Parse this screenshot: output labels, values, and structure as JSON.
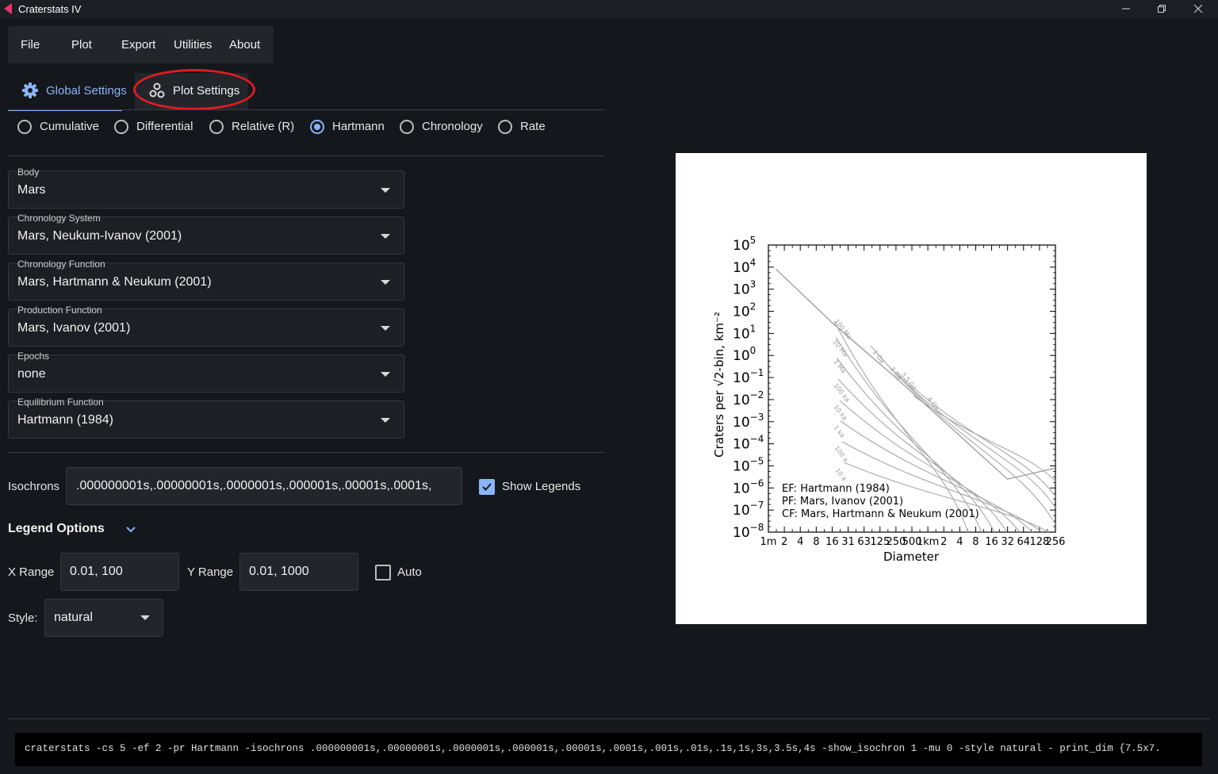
{
  "window": {
    "title": "Craterstats IV",
    "icon": "craterstats-logo-icon",
    "controls": [
      "minimize-icon",
      "maximize-icon",
      "close-icon"
    ]
  },
  "menu": [
    "File",
    "Plot",
    "Export",
    "Utilities",
    "About"
  ],
  "tabs": [
    {
      "label": "Global Settings",
      "icon": "gear-icon",
      "active": true
    },
    {
      "label": "Plot Settings",
      "icon": "plot-settings-icon",
      "active": false,
      "highlighted": true
    }
  ],
  "presentation": {
    "options": [
      "Cumulative",
      "Differential",
      "Relative (R)",
      "Hartmann",
      "Chronology",
      "Rate"
    ],
    "selected": "Hartmann"
  },
  "selects": [
    {
      "label": "Body",
      "value": "Mars"
    },
    {
      "label": "Chronology System",
      "value": "Mars, Neukum-Ivanov (2001)"
    },
    {
      "label": "Chronology Function",
      "value": "Mars, Hartmann & Neukum (2001)"
    },
    {
      "label": "Production Function",
      "value": "Mars, Ivanov (2001)"
    },
    {
      "label": "Epochs",
      "value": "none"
    },
    {
      "label": "Equilibrium Function",
      "value": "Hartmann (1984)"
    }
  ],
  "isochrons": {
    "label": "Isochrons",
    "value": ".000000001s,.00000001s,.0000001s,.000001s,.00001s,.0001s,"
  },
  "show_legends": {
    "label": "Show Legends",
    "checked": true
  },
  "legend_options": {
    "label": "Legend Options",
    "icon": "chevron-down-icon"
  },
  "x_range": {
    "label": "X Range",
    "value": "0.01, 100"
  },
  "y_range": {
    "label": "Y Range",
    "value": "0.01, 1000"
  },
  "auto": {
    "label": "Auto",
    "checked": false
  },
  "style": {
    "label": "Style:",
    "value": "natural"
  },
  "plot": {
    "ylabel": "Craters per √2-bin, km⁻²",
    "xlabel": "Diameter",
    "y_tick_exponents": [
      "5",
      "4",
      "3",
      "2",
      "1",
      "0",
      "−1",
      "−2",
      "−3",
      "−4",
      "−5",
      "−6",
      "−7",
      "−8"
    ],
    "x_tick_labels": [
      "1m",
      "2",
      "4",
      "8",
      "16",
      "31",
      "63",
      "125",
      "250",
      "500",
      "1km",
      "2",
      "4",
      "8",
      "16",
      "32",
      "64",
      "128",
      "256"
    ],
    "legend": [
      "EF: Hartmann (1984)",
      "PF: Mars, Ivanov (2001)",
      "CF: Mars, Hartmann & Neukum (2001)"
    ],
    "isochron_labels": [
      "100 Ma",
      "10 Ma",
      "1 Ma",
      "100 ka",
      "10 ka",
      "1 ka",
      "100 a",
      "10 a",
      "1 Ga",
      "3 Ga",
      "3.5 Ga",
      "4 Ga"
    ]
  },
  "chart_data": {
    "type": "line",
    "title": "",
    "xlabel": "Diameter",
    "ylabel": "Craters per √2-bin, km⁻²",
    "x_scale": "log",
    "y_scale": "log",
    "xlim_km": [
      0.001,
      256
    ],
    "ylim": [
      1e-08,
      100000.0
    ],
    "grid": false,
    "legend_placement": "bottom-left",
    "series": [
      {
        "name": "EF: Hartmann (1984)",
        "x_km": [
          0.0014,
          0.016,
          0.25,
          32,
          256
        ],
        "y": [
          8000,
          30,
          0.1,
          2.5e-06,
          8e-06
        ]
      }
    ]
  },
  "command": "craterstats -cs 5 -ef 2 -pr Hartmann -isochrons .000000001s,.00000001s,.0000001s,.000001s,.00001s,.0001s,.001s,.01s,.1s,1s,3s,3.5s,4s -show_isochron 1 -mu 0 -style natural - print_dim {7.5x7.",
  "colors": {
    "accent": "#8ab4f8",
    "highlight_ring": "#e01b24",
    "background": "#14171b"
  }
}
